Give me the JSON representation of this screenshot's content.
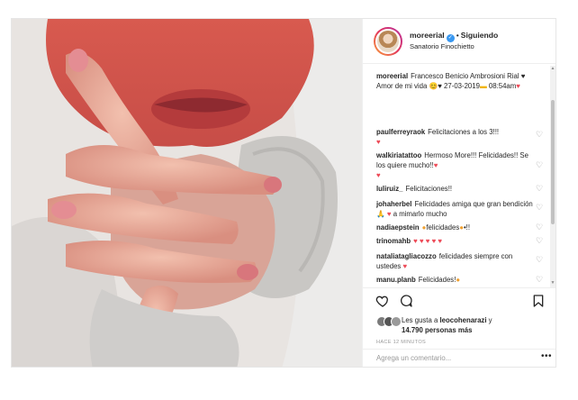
{
  "post": {
    "username": "moreerial",
    "verified_icon": "verified-check-icon",
    "separator": "•",
    "follow_status": "Siguiendo",
    "location": "Sanatorio Finochietto",
    "photo_icon": "newborn-hand-photo"
  },
  "comments": [
    {
      "user": "moreerial",
      "text": "Francesco Benicio Ambrosioni Rial",
      "text2": "Amor de mi vida",
      "text3": "27-03-2019",
      "text4": "08:54am"
    },
    {
      "user": "paulferreyraok",
      "text": "Felicitaciones a los 3!!!"
    },
    {
      "user": "walkiriatattoo",
      "text": "Hermoso More!!! Felicidades!! Se los quiere mucho!!"
    },
    {
      "user": "luliruiz_",
      "text": "Felicitaciones!!"
    },
    {
      "user": "johaherbel",
      "text": "Felicidades amiga que gran bendición",
      "text2": "a mimarlo mucho"
    },
    {
      "user": "nadiaepstein",
      "text": "felicidades",
      "text2": "•!!"
    },
    {
      "user": "trinomahb",
      "text": ""
    },
    {
      "user": "nataliatagliacozzo",
      "text": "felicidades siempre con ustedes"
    },
    {
      "user": "manu.planb",
      "text": "Felicidades!"
    }
  ],
  "likes": {
    "prefix": "Les gusta a",
    "user": "leocohenarazi",
    "connector": "y",
    "count": "14.790 personas más"
  },
  "time_ago": "HACE 12 MINUTOS",
  "add_comment": {
    "placeholder": "Agrega un comentario..."
  },
  "more_label": "•••",
  "icons": {
    "like": "heart-outline-icon",
    "comment": "comment-bubble-icon",
    "save": "bookmark-icon",
    "comment_like": "small-heart-icon"
  },
  "colors": {
    "red_heart": "#ed4956",
    "verified_blue": "#3897f0",
    "border": "#efefef"
  }
}
